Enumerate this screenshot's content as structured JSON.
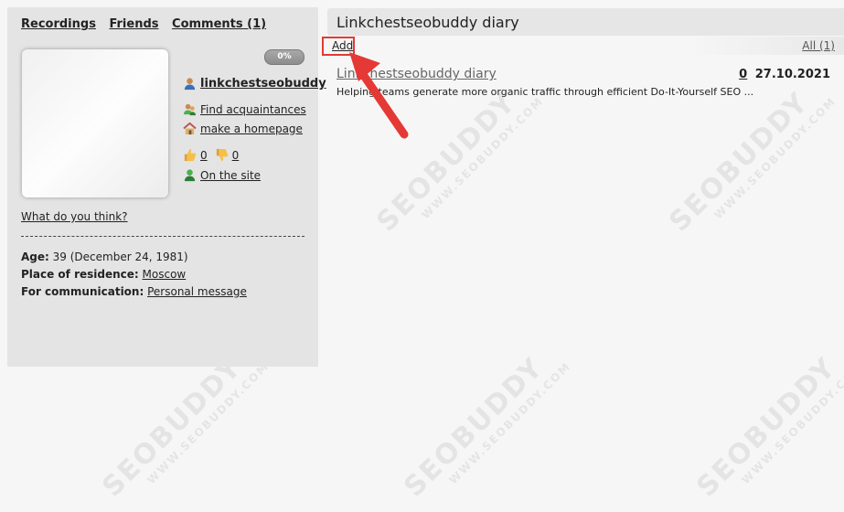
{
  "nav": {
    "recordings": "Recordings",
    "friends": "Friends",
    "comments": "Comments (1)"
  },
  "profile": {
    "progress": "0%",
    "username": "linkchestseobuddy",
    "find_acquaintances": "Find acquaintances",
    "make_homepage": "make a homepage",
    "likes": "0",
    "dislikes": "0",
    "on_site": "On the site",
    "what_think": "What do you think?",
    "age_label": "Age:",
    "age_value": "39 (December 24, 1981)",
    "residence_label": "Place of residence:",
    "residence_value": "Moscow",
    "communication_label": "For communication:",
    "communication_value": "Personal message"
  },
  "diary": {
    "title": "Linkchestseobuddy diary",
    "add": "Add",
    "all": "All (1)",
    "entries": [
      {
        "title": "Linkchestseobuddy diary",
        "comments": "0",
        "date": "27.10.2021",
        "snippet": "Helping teams generate more organic traffic through efficient Do-It-Yourself SEO ..."
      }
    ]
  },
  "watermark": {
    "brand": "SEOBUDDY",
    "site": "WWW.SEOBUDDY.COM"
  },
  "colors": {
    "highlight": "#e53935",
    "panel": "#e4e4e4",
    "background": "#f6f6f6"
  }
}
